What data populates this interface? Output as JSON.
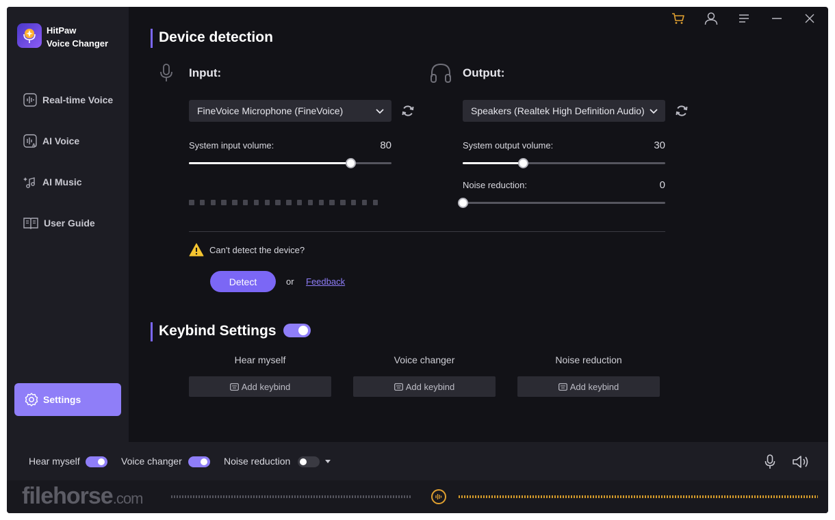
{
  "app": {
    "name_line1": "HitPaw",
    "name_line2": "Voice Changer"
  },
  "sidebar": {
    "items": [
      {
        "label": "Real-time Voice",
        "icon": "waveform-icon"
      },
      {
        "label": "AI Voice",
        "icon": "ai-voice-icon"
      },
      {
        "label": "AI Music",
        "icon": "music-note-icon"
      },
      {
        "label": "User Guide",
        "icon": "book-icon"
      }
    ],
    "settings_label": "Settings"
  },
  "device": {
    "title": "Device detection",
    "input": {
      "label": "Input:",
      "device": "FineVoice Microphone (FineVoice)",
      "volume_label": "System input volume:",
      "volume": "80",
      "volume_fraction": 0.8
    },
    "output": {
      "label": "Output:",
      "device": "Speakers (Realtek High Definition Audio)",
      "volume_label": "System output volume:",
      "volume": "30",
      "volume_fraction": 0.3,
      "noise_label": "Noise reduction:",
      "noise": "0",
      "noise_fraction": 0
    },
    "warning": "Can't detect the device?",
    "detect_label": "Detect",
    "or_text": "or",
    "feedback_label": "Feedback"
  },
  "keybind": {
    "title": "Keybind Settings",
    "enabled": true,
    "columns": [
      {
        "label": "Hear myself",
        "button": "Add keybind"
      },
      {
        "label": "Voice changer",
        "button": "Add keybind"
      },
      {
        "label": "Noise reduction",
        "button": "Add keybind"
      }
    ]
  },
  "bottom": {
    "hear_myself": "Hear myself",
    "hear_myself_on": true,
    "voice_changer": "Voice changer",
    "voice_changer_on": true,
    "noise_reduction": "Noise reduction",
    "noise_reduction_on": false
  },
  "watermark": {
    "main": "filehorse",
    "suffix": ".com"
  },
  "colors": {
    "accent": "#7b67f5",
    "sidebar": "#1d1d24",
    "background": "#121217",
    "wave": "#d39a2a"
  }
}
